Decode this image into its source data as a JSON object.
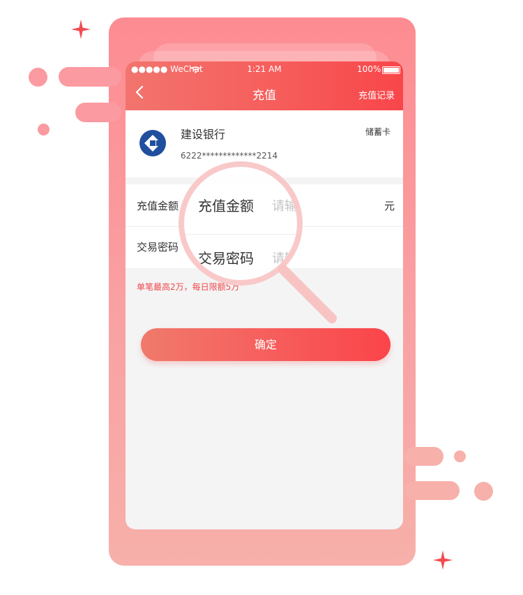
{
  "status_bar": {
    "carrier": "●●●●● WeChat",
    "time": "1:21 AM",
    "battery": "100%"
  },
  "nav": {
    "title": "充值",
    "right_link": "充值记录",
    "back_icon": "chevron-left-icon"
  },
  "bank_card": {
    "bank_name": "建设银行",
    "card_number": "6222*************2214",
    "card_type": "储蓄卡",
    "logo_icon": "ccb-logo-icon",
    "logo_color": "#1f4f9e"
  },
  "form": {
    "amount_label": "充值金额",
    "amount_unit": "元",
    "password_label": "交易密码"
  },
  "hint": "单笔最高2万，每日限额5万",
  "submit_label": "确定",
  "magnifier": {
    "amount_label": "充值金额",
    "amount_placeholder": "请输",
    "password_label": "交易密码",
    "password_placeholder": "请输"
  },
  "colors": {
    "accent_start": "#f2746e",
    "accent_end": "#f8464a",
    "background_card": "#fd8c92",
    "spark": "#f24b50"
  }
}
